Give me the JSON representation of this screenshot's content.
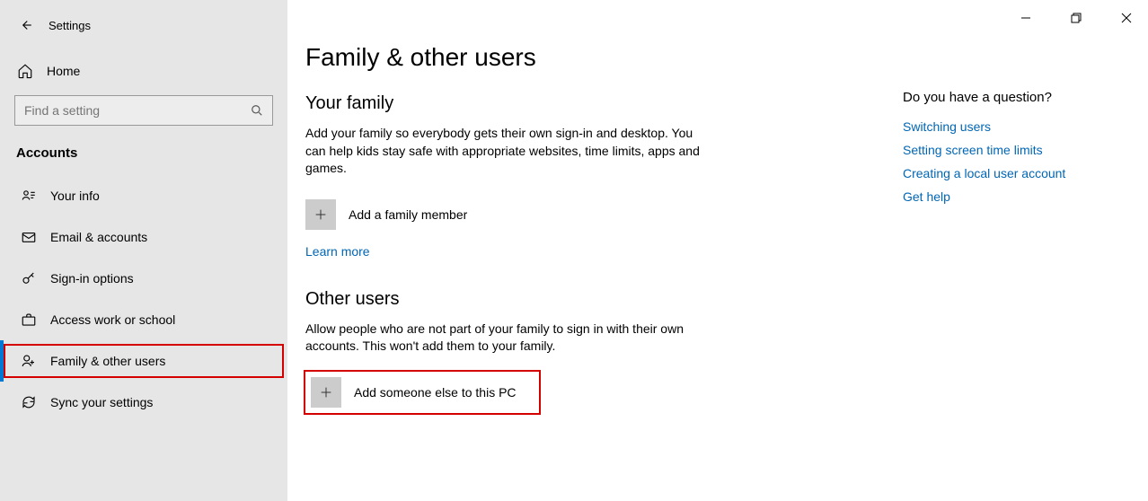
{
  "app_title": "Settings",
  "home_label": "Home",
  "search_placeholder": "Find a setting",
  "category": "Accounts",
  "nav": [
    {
      "label": "Your info"
    },
    {
      "label": "Email & accounts"
    },
    {
      "label": "Sign-in options"
    },
    {
      "label": "Access work or school"
    },
    {
      "label": "Family & other users"
    },
    {
      "label": "Sync your settings"
    }
  ],
  "page_title": "Family & other users",
  "family": {
    "heading": "Your family",
    "desc": "Add your family so everybody gets their own sign-in and desktop. You can help kids stay safe with appropriate websites, time limits, apps and games.",
    "add_label": "Add a family member",
    "learn_more": "Learn more"
  },
  "other": {
    "heading": "Other users",
    "desc": "Allow people who are not part of your family to sign in with their own accounts. This won't add them to your family.",
    "add_label": "Add someone else to this PC"
  },
  "help": {
    "heading": "Do you have a question?",
    "links": [
      "Switching users",
      "Setting screen time limits",
      "Creating a local user account",
      "Get help"
    ]
  }
}
